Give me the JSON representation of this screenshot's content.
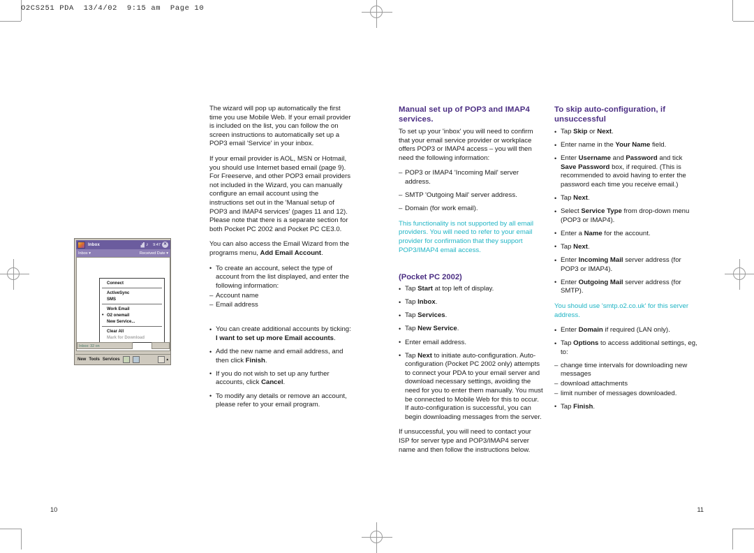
{
  "running_head": "O2CS251 PDA  13/4/02  9:15 am  Page 10",
  "folios": {
    "left": "10",
    "right": "11"
  },
  "colors": {
    "heading_purple": "#4b2e83",
    "note_teal": "#1fb4c4",
    "pda_titlebar_purple": "#6b5c9e"
  },
  "left_column": {
    "paragraphs": [
      "The wizard will pop up automatically the first time you use Mobile Web. If your email provider is included on the list, you can follow the on screen instructions to automatically set up a POP3 email 'Service' in your inbox.",
      "If your email provider is AOL, MSN or Hotmail, you should use Internet based email (page 9). For Freeserve, and other POP3 email providers not included in the Wizard, you can manually configure an email account using the instructions set out in the 'Manual setup of POP3 and IMAP4 services' (pages 11 and 12). Please note that there is a separate section for both Pocket PC 2002 and Pocket PC CE3.0.",
      "You can also access the Email Wizard from the programs menu, Add Email Account."
    ],
    "paragraph3_plain": "You can also access the Email Wizard from the programs menu, ",
    "paragraph3_bold": "Add Email Account",
    "paragraph3_tail": ".",
    "bullets": [
      {
        "type": "bullet",
        "text": "To create an account, select the type of account from the list displayed, and enter the following information:"
      },
      {
        "type": "dash",
        "text": "Account name"
      },
      {
        "type": "dash",
        "text": "Email address"
      }
    ],
    "bullet_additional": {
      "pre": "You can create additional accounts by ticking: ",
      "bold": "I want to set up more Email accounts",
      "post": "."
    },
    "bullet_add_new": {
      "pre": "Add the new name and email address, and then click ",
      "bold": "Finish",
      "post": "."
    },
    "bullet_no_further": {
      "pre": "If you do not wish to set up any further accounts, click ",
      "bold": "Cancel",
      "post": "."
    },
    "bullet_modify": {
      "pre": "To modify any details or remove an account, please refer to your email program.",
      "bold": "",
      "post": ""
    }
  },
  "middle_column": {
    "heading": "Manual set up of POP3 and IMAP4 services.",
    "intro": "To set up your 'inbox' you will need to confirm that your email service provider or workplace offers POP3 or IMAP4 access – you will then need the following information:",
    "requirements": [
      "POP3 or IMAP4 'Incoming Mail' server address.",
      "SMTP 'Outgoing Mail' server address.",
      "Domain (for work email)."
    ],
    "note": "This functionality is not supported by all email providers. You will need to refer to your email provider for confirmation that they support POP3/IMAP4 email access.",
    "subheading": "(Pocket PC 2002)",
    "steps": [
      {
        "pre": "Tap ",
        "bold": "Start",
        "post": " at top left of display."
      },
      {
        "pre": "Tap ",
        "bold": "Inbox",
        "post": "."
      },
      {
        "pre": "Tap ",
        "bold": "Services",
        "post": "."
      },
      {
        "pre": "Tap ",
        "bold": "New Service",
        "post": "."
      },
      {
        "pre": "Enter email address.",
        "bold": "",
        "post": ""
      }
    ],
    "auto_config": {
      "pre": "Tap ",
      "bold": "Next",
      "post": " to initiate auto-configuration. Auto-configuration (Pocket PC 2002 only) attempts to connect your PDA to your email server and download necessary settings, avoiding the need for you to enter them manually. You must be connected to Mobile Web for this to occur. If auto-configuration is successful, you can begin downloading messages from the server."
    },
    "closing": "If unsuccessful, you will need to contact your ISP for server type and POP3/IMAP4 server name and then follow the instructions below."
  },
  "right_column": {
    "heading": "To skip auto-configuration, if unsuccessful",
    "steps": [
      {
        "pre": "Tap ",
        "bold": "Skip",
        "mid": " or ",
        "bold2": "Next",
        "post": "."
      },
      {
        "pre": "Enter name in the ",
        "bold": "Your Name",
        "post": " field."
      },
      {
        "pre": "Enter ",
        "bold": "Username",
        "mid": " and ",
        "bold2": "Password",
        "post": " and tick ",
        "bold3": "Save Password",
        "post2": " box, if required. (This is recommended to avoid having to enter the password each time you receive email.)"
      },
      {
        "pre": "Tap ",
        "bold": "Next",
        "post": "."
      },
      {
        "pre": "Select ",
        "bold": "Service Type",
        "post": " from drop-down menu (POP3 or IMAP4)."
      },
      {
        "pre": "Enter a ",
        "bold": "Name",
        "post": " for the account."
      },
      {
        "pre": "Tap ",
        "bold": "Next",
        "post": "."
      },
      {
        "pre": "Enter ",
        "bold": "Incoming Mail",
        "post": " server address (for POP3 or IMAP4)."
      },
      {
        "pre": "Enter ",
        "bold": "Outgoing Mail",
        "post": " server address (for SMTP)."
      }
    ],
    "note": "You should use 'smtp.o2.co.uk' for this server address.",
    "steps2": [
      {
        "pre": "Enter ",
        "bold": "Domain",
        "post": " if required (LAN only)."
      },
      {
        "pre": "Tap ",
        "bold": "Options",
        "post": " to access additional settings, eg, to:"
      }
    ],
    "options_list": [
      "change time intervals for downloading new messages",
      "download attachments",
      "limit number of messages downloaded."
    ],
    "final_step": {
      "pre": "Tap ",
      "bold": "Finish",
      "post": "."
    }
  },
  "pda_screenshot": {
    "title": "Inbox",
    "clock": "9:47",
    "tray_icons": [
      "signal-icon",
      "speaker-icon",
      "close-icon"
    ],
    "subbar_left": "Inbox",
    "subbar_right": "Received Date",
    "menu_items": [
      {
        "label": "Connect",
        "checked": false,
        "disabled": false
      },
      {
        "label": "ActiveSync",
        "checked": false,
        "disabled": false
      },
      {
        "label": "SMS",
        "checked": false,
        "disabled": false
      },
      {
        "label": "Work Email",
        "checked": false,
        "disabled": false
      },
      {
        "label": "O2 onemail",
        "checked": true,
        "disabled": false
      },
      {
        "label": "New Service...",
        "checked": false,
        "disabled": false
      },
      {
        "label": "Clear All",
        "checked": false,
        "disabled": false
      },
      {
        "label": "Mark for Download",
        "checked": false,
        "disabled": true
      }
    ],
    "status_text": "Inbox: 32 on",
    "toolbar": [
      "New",
      "Tools",
      "Services"
    ]
  }
}
